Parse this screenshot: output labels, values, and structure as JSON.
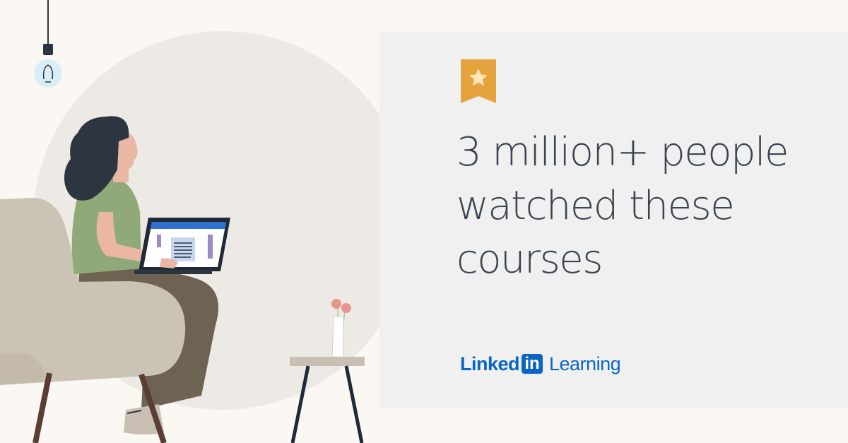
{
  "headline": {
    "line1": "3 million+ people",
    "line2": "watched these",
    "line3": "courses"
  },
  "logo": {
    "word1": "Linked",
    "mark": "in",
    "word2": "Learning"
  },
  "badge": {
    "icon": "star-icon",
    "color": "#e6a23c"
  },
  "colors": {
    "background": "#fbf8f3",
    "panel": "#f0f0f0",
    "text": "#3a4350",
    "brand": "#0a66c2",
    "dark_shape": "#38424d"
  }
}
